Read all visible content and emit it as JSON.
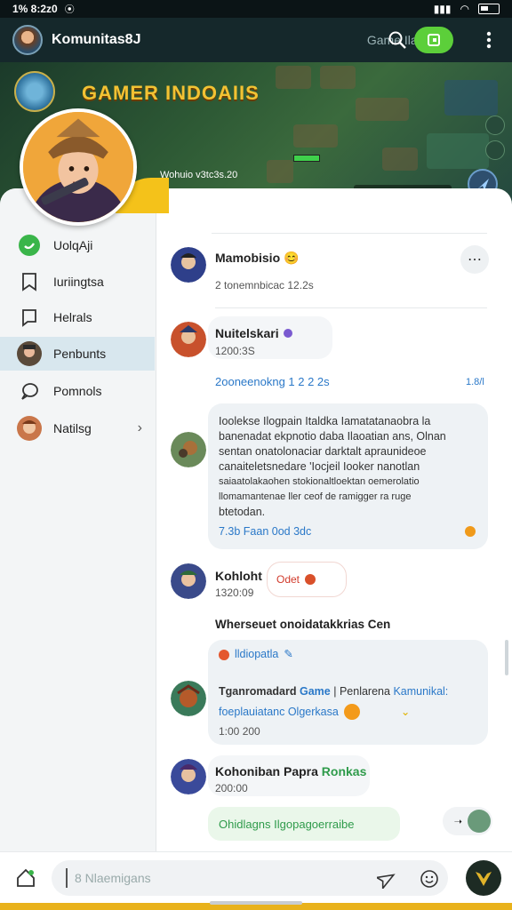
{
  "status_bar": {
    "time": "1% 8:2z0"
  },
  "app_bar": {
    "title": "Komunitas8J",
    "subtitle": "Game Ilatams",
    "search_icon": "search-icon",
    "menu_icon": "kebab-icon"
  },
  "banner": {
    "title": "GAMER INDOAIIS",
    "caption": "Wohuio v3tc3s.20"
  },
  "sidebar": {
    "items": [
      {
        "label": "UolqAji",
        "icon": "phone-green-icon"
      },
      {
        "label": "Iuriingtsa",
        "icon": "bookmark-icon"
      },
      {
        "label": "Helrals",
        "icon": "message-square-icon"
      },
      {
        "label": "Penbunts",
        "icon": "avatar",
        "active": true
      },
      {
        "label": "Pomnols",
        "icon": "chat-bubble-icon"
      },
      {
        "label": "Natilsg",
        "icon": "avatar"
      }
    ]
  },
  "feed": {
    "post1": {
      "name": "Mamobisio",
      "emoji": "😊",
      "meta": "2 tonemnbicac 12.2s"
    },
    "post2": {
      "name": "Nuitelskari",
      "meta": "1200:3S",
      "link": "2ooneenokng 1 2 2 2s",
      "link_right": "1.8/l"
    },
    "post3": {
      "lines": [
        "Ioolekse Ilogpain Italdka Iamatatanaobra la",
        "banenadat ekpnotio daba Ilaoatian ans, Olnan",
        "sentan onatolonaciar darktalt apraunideoe",
        "canaiteletsnedare 'Iocjeil Iooker nanotlan",
        "saiaatolakaohen stokionaltloektan oemerolatio",
        "llomamantenae ller ceof de ramigger ra ruge",
        "btetodan."
      ],
      "stamp": "7.3b Faan 0od 3dc"
    },
    "post4": {
      "name": "Kohloht",
      "pill": "Odet",
      "meta": "1320:09",
      "heading": "Wherseuet onoidatakkrias Cen"
    },
    "post5": {
      "tag": "lldiopatla",
      "line1_a": "Tganromadard",
      "line1_b": "Game",
      "line1_c": "| Penlarena",
      "line1_d": "Kamunikal:",
      "line2": "foeplauiatanc Olgerkasa",
      "time": "1:00 200"
    },
    "post6": {
      "name": "Kohoniban Papra",
      "name_green": "Ronkas",
      "meta": "200:00",
      "chip": "Ohidlagns Ilgopagoerraibe"
    }
  },
  "composer": {
    "placeholder": "8 Nlaemigans"
  },
  "colors": {
    "accent_green": "#5ccf3a",
    "banner_gold": "#f2c233",
    "link_blue": "#2a78c8"
  }
}
